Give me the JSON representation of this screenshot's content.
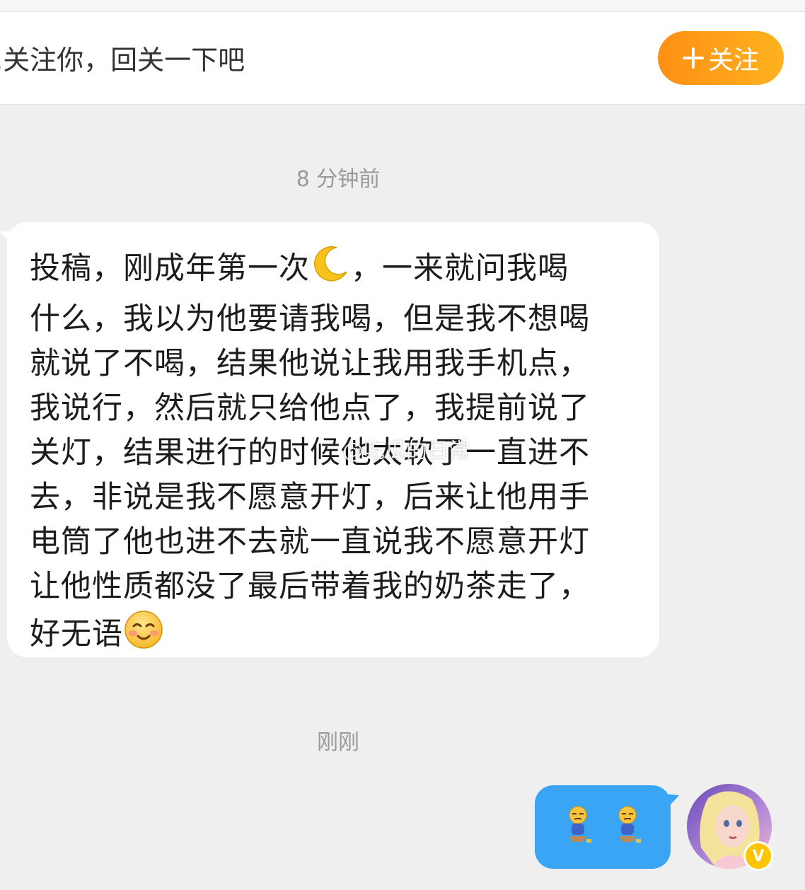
{
  "follow_bar": {
    "text": ",关注你，回关一下吧",
    "button_label": "关注"
  },
  "messages": [
    {
      "timestamp": "8 分钟前",
      "direction": "incoming",
      "lines": [
        "投稿，刚成年第一次",
        "，一来就问我喝",
        "什么，我以为他要请我喝，但是我不想喝\n就说了不喝，结果他说让我用我手机点，\n我说行，然后就只给他点了，我提前说了\n关灯，结果进行的时候他太软了一直进不\n去，非说是我不愿意开灯，后来让他用手\n电筒了他也进不去就一直说我不愿意开灯\n让他性质都没了最后带着我的奶茶走了，\n好无语"
      ],
      "emojis": [
        "crescent-moon",
        "smiling-face-blush"
      ]
    },
    {
      "timestamp": "刚刚",
      "direction": "outgoing",
      "emojis": [
        "person-sitting-sad",
        "person-sitting-sad"
      ]
    }
  ],
  "watermark": "@吃瓜的日常",
  "colors": {
    "background": "#efefef",
    "follow_button": "#ff9a16",
    "outgoing_bubble": "#3aa4f5",
    "vip_badge": "#ffc400"
  }
}
